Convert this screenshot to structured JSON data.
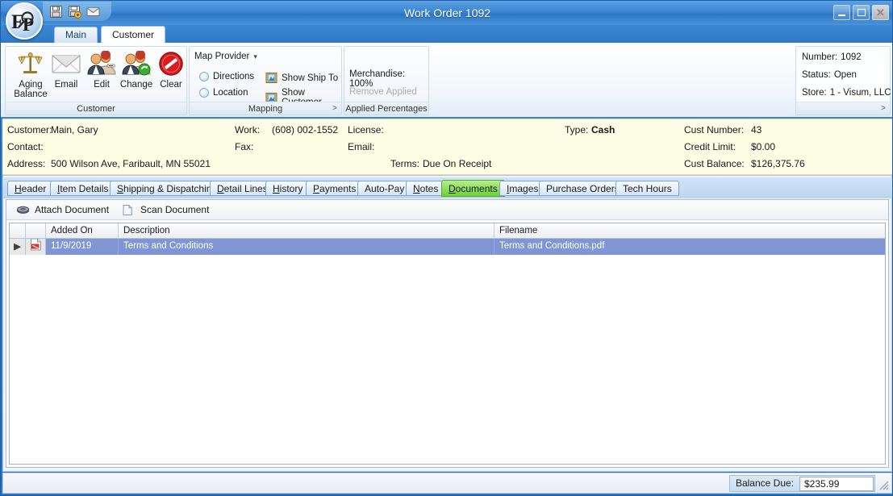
{
  "window": {
    "title": "Work Order 1092",
    "minimize_label": "Minimize",
    "maximize_label": "Maximize",
    "close_label": "Close"
  },
  "quick_access": [
    {
      "name": "save-icon",
      "label": "Save"
    },
    {
      "name": "save-and-new-icon",
      "label": "Save and New"
    },
    {
      "name": "email-icon",
      "label": "Email"
    }
  ],
  "ribbon": {
    "tabs": [
      {
        "label": "Main",
        "active": false
      },
      {
        "label": "Customer",
        "active": true
      }
    ],
    "groups": [
      {
        "name": "customer",
        "label": "Customer",
        "buttons": [
          {
            "label": "Aging\nBalance",
            "label_line1": "Aging",
            "label_line2": "Balance",
            "icon": "scales-icon"
          },
          {
            "label": "Email",
            "icon": "envelope-icon"
          },
          {
            "label": "Edit",
            "icon": "users-edit-icon"
          },
          {
            "label": "Change",
            "icon": "users-change-icon"
          },
          {
            "label": "Clear",
            "icon": "no-entry-icon"
          }
        ]
      },
      {
        "name": "mapping",
        "label": "Mapping",
        "header": "Map Provider",
        "radios": [
          {
            "label": "Directions",
            "selected": false
          },
          {
            "label": "Location",
            "selected": false
          }
        ],
        "links": [
          {
            "label": "Show Ship To",
            "icon": "map-icon"
          },
          {
            "label": "Show Customer",
            "icon": "map-icon"
          }
        ],
        "expand_label": ">"
      },
      {
        "name": "applied-percentages",
        "label": "Applied Percentages",
        "items": [
          {
            "label": "Merchandise: 100%",
            "disabled": false
          },
          {
            "label": "Remove Applied",
            "disabled": true
          }
        ]
      }
    ]
  },
  "status_box": {
    "expand_label": ">",
    "rows": [
      {
        "label": "Number:",
        "value": "1092"
      },
      {
        "label": "Status:",
        "value": "Open"
      },
      {
        "label": "Store:",
        "value": "1 - Visum, LLC"
      }
    ]
  },
  "customer_info": {
    "col1": [
      {
        "label": "Customer:",
        "value": "Main, Gary"
      },
      {
        "label": "Contact:",
        "value": ""
      },
      {
        "label": "Address:",
        "value": "500 Wilson Ave, Faribault, MN 55021"
      }
    ],
    "col2": [
      {
        "label": "Work:",
        "value": "(608) 002-1552"
      },
      {
        "label": "Fax:",
        "value": ""
      },
      {
        "label": "Terms:",
        "value": "Due On Receipt"
      }
    ],
    "col3": [
      {
        "label": "License:",
        "value": ""
      },
      {
        "label": "Email:",
        "value": ""
      }
    ],
    "col4": [
      {
        "label": "Type:",
        "value": "Cash"
      }
    ],
    "col5": [
      {
        "label": "Cust Number:",
        "value": "43"
      },
      {
        "label": "Credit Limit:",
        "value": "$0.00"
      },
      {
        "label": "Cust Balance:",
        "value": "$126,375.76"
      }
    ]
  },
  "page_tabs": [
    {
      "label": "Header",
      "accel": "H",
      "active": false
    },
    {
      "label": "Item Details",
      "accel": "I",
      "active": false
    },
    {
      "label": "Shipping & Dispatching",
      "accel": "S",
      "active": false
    },
    {
      "label": "Detail Lines",
      "accel": "D",
      "active": false
    },
    {
      "label": "History",
      "accel": "H",
      "active": false
    },
    {
      "label": "Payments",
      "accel": "P",
      "active": false
    },
    {
      "label": "Auto-Pay",
      "accel": "",
      "active": false
    },
    {
      "label": "Notes",
      "accel": "N",
      "active": false
    },
    {
      "label": "Documents",
      "accel": "D",
      "active": true
    },
    {
      "label": "Images",
      "accel": "I",
      "active": false
    },
    {
      "label": "Purchase Orders",
      "accel": "",
      "active": false
    },
    {
      "label": "Tech Hours",
      "accel": "",
      "active": false
    }
  ],
  "documents_panel": {
    "toolbar": [
      {
        "label": "Attach Document",
        "icon": "paperclip-icon"
      },
      {
        "label": "Scan Document",
        "icon": "scanner-icon"
      }
    ],
    "grid": {
      "columns": [
        "",
        "",
        "Added On",
        "Description",
        "Filename"
      ],
      "rows": [
        {
          "row_indicator": "▶",
          "file_icon": "pdf-icon",
          "added_on": "11/9/2019",
          "description": "Terms and Conditions",
          "filename": "Terms and Conditions.pdf",
          "selected": true
        }
      ]
    }
  },
  "status_bar": {
    "balance_label": "Balance Due:",
    "balance_value": "$235.99"
  },
  "colors": {
    "title_blue": "#2f7ccc",
    "active_tab_green": "#8ade5a",
    "info_strip": "#fdfce4",
    "row_selected": "#8095d4"
  }
}
